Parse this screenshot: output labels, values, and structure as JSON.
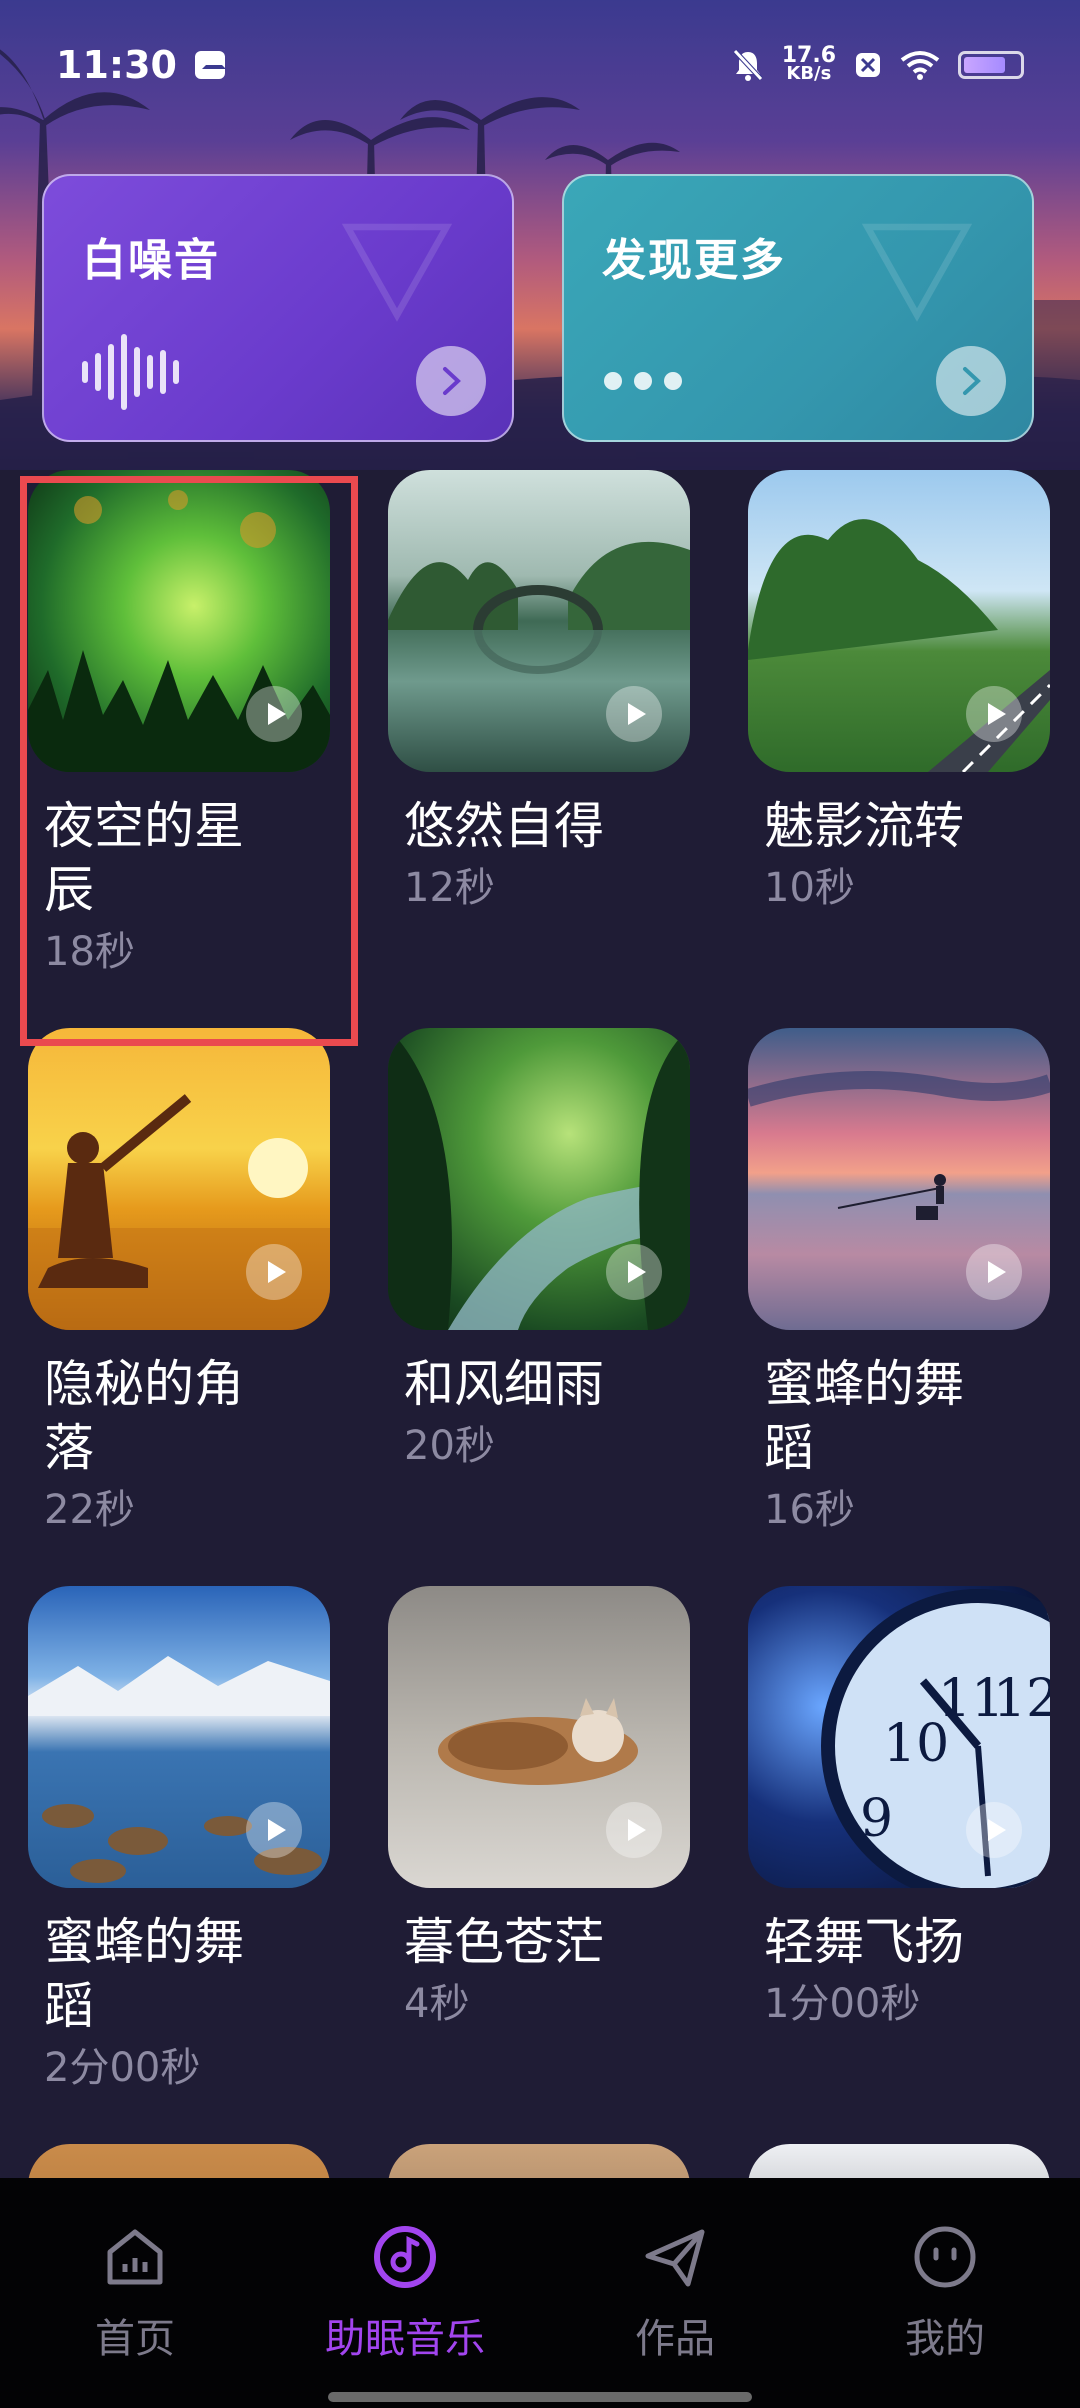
{
  "status_bar": {
    "time": "11:30",
    "net_speed_value": "17.6",
    "net_speed_unit": "KB/s",
    "battery_level": 0.75
  },
  "top_cards": {
    "white_noise": {
      "title": "白噪音"
    },
    "discover_more": {
      "title": "发现更多"
    }
  },
  "tracks": [
    {
      "title": "夜空的星辰",
      "duration": "18秒",
      "scene": "forest-glow"
    },
    {
      "title": "悠然自得",
      "duration": "12秒",
      "scene": "bridge-lake"
    },
    {
      "title": "魅影流转",
      "duration": "10秒",
      "scene": "road-trees"
    },
    {
      "title": "隐秘的角落",
      "duration": "22秒",
      "scene": "sunset-yoga"
    },
    {
      "title": "和风细雨",
      "duration": "20秒",
      "scene": "jungle-stream"
    },
    {
      "title": "蜜蜂的舞蹈",
      "duration": "16秒",
      "scene": "fisher-sunset"
    },
    {
      "title": "蜜蜂的舞蹈",
      "duration": "2分00秒",
      "scene": "mountain-river"
    },
    {
      "title": "暮色苍茫",
      "duration": "4秒",
      "scene": "sleeping-kitten"
    },
    {
      "title": "轻舞飞扬",
      "duration": "1分00秒",
      "scene": "clock"
    }
  ],
  "bottom_nav": [
    {
      "label": "首页",
      "icon": "home-chart-icon",
      "active": false
    },
    {
      "label": "助眠音乐",
      "icon": "music-disc-icon",
      "active": true
    },
    {
      "label": "作品",
      "icon": "paper-plane-icon",
      "active": false
    },
    {
      "label": "我的",
      "icon": "face-icon",
      "active": false
    }
  ],
  "colors": {
    "background": "#1f1c35",
    "active_nav": "#a245ef",
    "inactive_nav": "#7d7a8b",
    "duration_text": "#8d8aa2",
    "selection_border": "#ea4a4f"
  }
}
